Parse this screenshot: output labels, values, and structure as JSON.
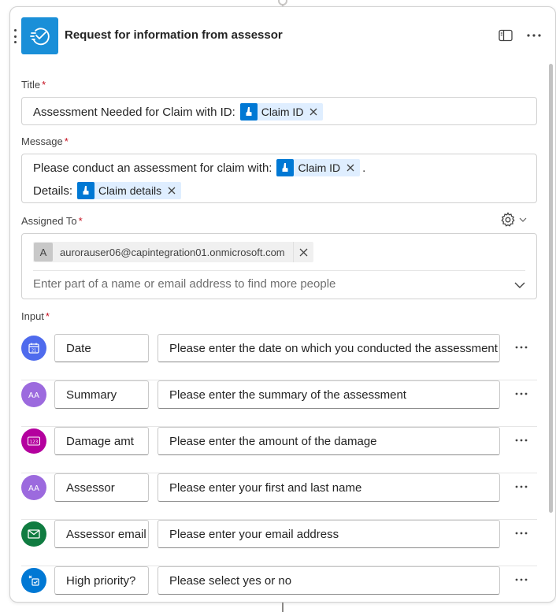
{
  "header": {
    "title": "Request for information from assessor"
  },
  "fields": {
    "title": {
      "label": "Title",
      "required_mark": "*",
      "prefix_text": "Assessment Needed for Claim with ID:",
      "token": "Claim ID"
    },
    "message": {
      "label": "Message",
      "required_mark": "*",
      "line1_text": "Please conduct an assessment for claim with:",
      "line1_token": "Claim ID",
      "line1_suffix": ".",
      "line2_text": "Details:",
      "line2_token": "Claim details"
    },
    "assigned_to": {
      "label": "Assigned To",
      "required_mark": "*",
      "persona_initial": "A",
      "persona_email": "aurorauser06@capintegration01.onmicrosoft.com",
      "placeholder": "Enter part of a name or email address to find more people"
    },
    "input": {
      "label": "Input",
      "required_mark": "*",
      "rows": [
        {
          "name": "Date",
          "description": "Please enter the date on which you conducted the assessment",
          "icon": "calendar-icon",
          "color": "#4f6bed"
        },
        {
          "name": "Summary",
          "description": "Please enter the summary of the assessment",
          "icon": "text-icon",
          "color": "#9c6ade"
        },
        {
          "name": "Damage amt",
          "description": "Please enter the amount of the damage",
          "icon": "number-icon",
          "color": "#b4009e"
        },
        {
          "name": "Assessor",
          "description": "Please enter your first and last name",
          "icon": "text-icon",
          "color": "#9c6ade"
        },
        {
          "name": "Assessor email",
          "description": "Please enter your email address",
          "icon": "mail-icon",
          "color": "#107c41"
        },
        {
          "name": "High priority?",
          "description": "Please select yes or no",
          "icon": "yes-no-icon",
          "color": "#0078d4"
        }
      ]
    }
  },
  "colors": {
    "accent": "#0078d4",
    "token_bg": "#dfeeff",
    "required": "#c50f1f"
  }
}
